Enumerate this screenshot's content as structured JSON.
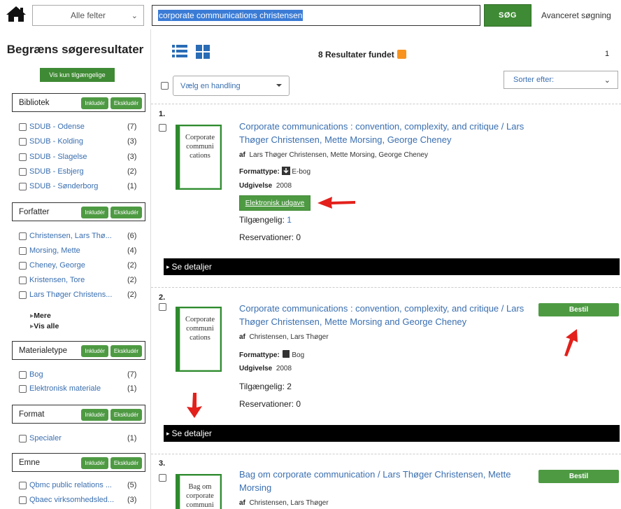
{
  "topbar": {
    "field_select": "Alle felter",
    "search_value": "corporate communications christensen",
    "search_button": "SØG",
    "advanced_link": "Avanceret søgning"
  },
  "sidebar": {
    "title": "Begræns søgeresultater",
    "available_button": "Vis kun tilgængelige",
    "include_label": "Inkludér",
    "exclude_label": "Ekskludér",
    "facets": [
      {
        "name": "Bibliotek",
        "items": [
          {
            "label": "SDUB - Odense",
            "count": "(7)"
          },
          {
            "label": "SDUB - Kolding",
            "count": "(3)"
          },
          {
            "label": "SDUB - Slagelse",
            "count": "(3)"
          },
          {
            "label": "SDUB - Esbjerg",
            "count": "(2)"
          },
          {
            "label": "SDUB - Sønderborg",
            "count": "(1)"
          }
        ]
      },
      {
        "name": "Forfatter",
        "items": [
          {
            "label": "Christensen, Lars Thø...",
            "count": "(6)"
          },
          {
            "label": "Morsing, Mette",
            "count": "(4)"
          },
          {
            "label": "Cheney, George",
            "count": "(2)"
          },
          {
            "label": "Kristensen, Tore",
            "count": "(2)"
          },
          {
            "label": "Lars Thøger Christens...",
            "count": "(2)"
          }
        ],
        "more": "Mere",
        "show_all": "Vis alle"
      },
      {
        "name": "Materialetype",
        "items": [
          {
            "label": "Bog",
            "count": "(7)"
          },
          {
            "label": "Elektronisk materiale",
            "count": "(1)"
          }
        ]
      },
      {
        "name": "Format",
        "items": [
          {
            "label": "Specialer",
            "count": "(1)"
          }
        ]
      },
      {
        "name": "Emne",
        "items": [
          {
            "label": "Qbmc public relations ...",
            "count": "(5)"
          },
          {
            "label": "Qbaec virksomhedsled...",
            "count": "(3)"
          }
        ]
      }
    ]
  },
  "main": {
    "results_text": "8 Resultater fundet",
    "page_number": "1",
    "action_select": "Vælg en handling",
    "sort_select": "Sorter efter:",
    "details_label": "Se detaljer",
    "order_label": "Bestil",
    "labels": {
      "by": "af",
      "format_type": "Formattype:",
      "published": "Udgivelse",
      "available": "Tilgængelig:",
      "reservations": "Reservationer:"
    },
    "records": [
      {
        "num": "1.",
        "cover_text": "Corporate communi cations",
        "title": "Corporate communications : convention, complexity, and critique / Lars Thøger Christensen, Mette Morsing, George Cheney",
        "authors": "Lars Thøger Christensen, Mette Morsing, George Cheney",
        "format": "E-bog",
        "year": "2008",
        "e_button": "Elektronisk udgave",
        "available": "1",
        "reservations": "0"
      },
      {
        "num": "2.",
        "cover_text": "Corporate communi cations",
        "title": "Corporate communications : convention, complexity, and critique / Lars Thøger Christensen, Mette Morsing and George Cheney",
        "authors": "Christensen, Lars Thøger",
        "format": "Bog",
        "year": "2008",
        "available": "2",
        "reservations": "0"
      },
      {
        "num": "3.",
        "cover_text": "Bag om corporate communi",
        "title": "Bag om corporate communication / Lars Thøger Christensen, Mette Morsing",
        "authors": "Christensen, Lars Thøger"
      }
    ]
  },
  "colors": {
    "green": "#4e9a43",
    "link": "#3a6fb0",
    "arrow_red": "#e3201b"
  }
}
